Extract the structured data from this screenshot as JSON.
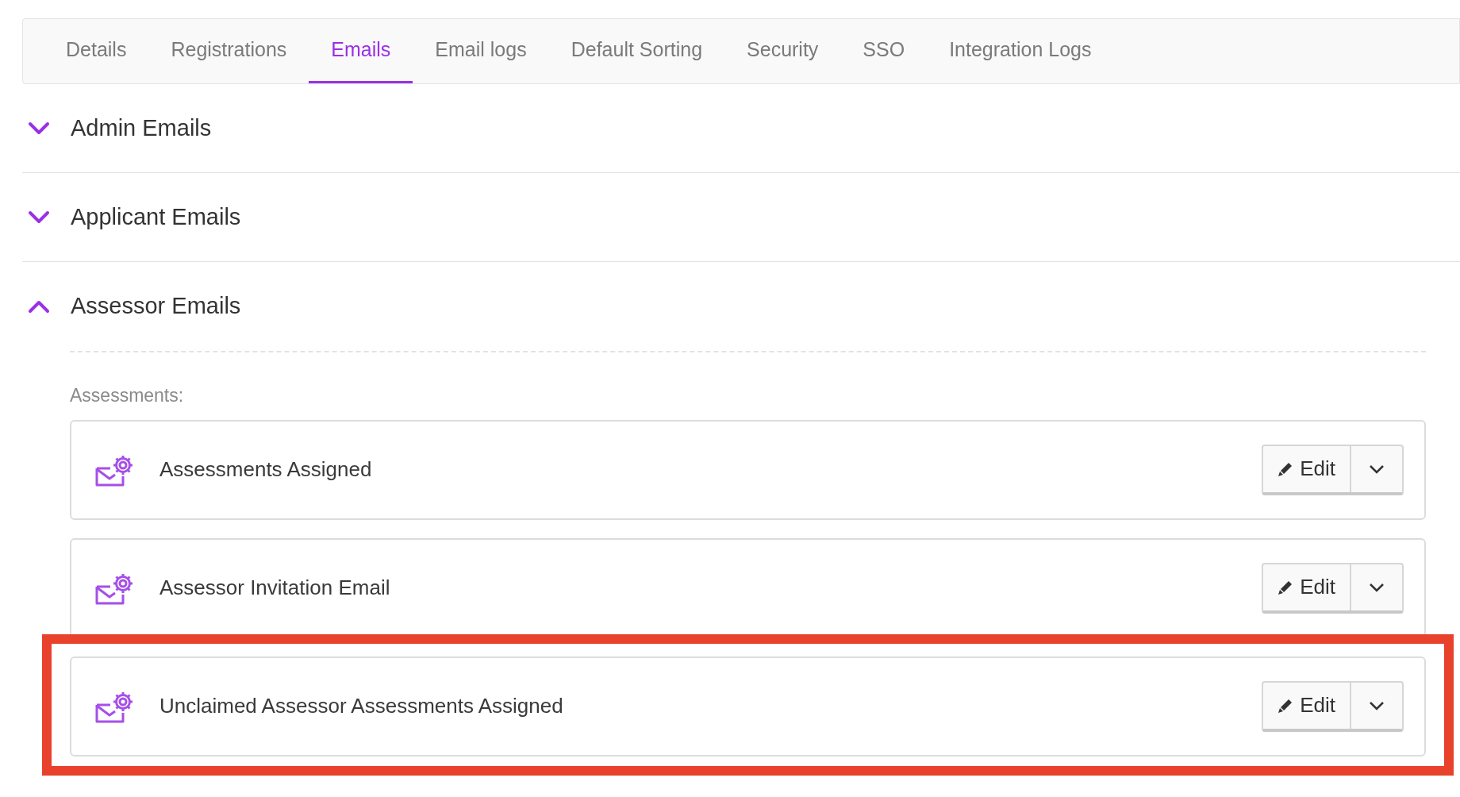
{
  "tabs": [
    {
      "label": "Details",
      "selected": false
    },
    {
      "label": "Registrations",
      "selected": false
    },
    {
      "label": "Emails",
      "selected": true
    },
    {
      "label": "Email logs",
      "selected": false
    },
    {
      "label": "Default Sorting",
      "selected": false
    },
    {
      "label": "Security",
      "selected": false
    },
    {
      "label": "SSO",
      "selected": false
    },
    {
      "label": "Integration Logs",
      "selected": false
    }
  ],
  "sections": [
    {
      "title": "Admin Emails",
      "expanded": false
    },
    {
      "title": "Applicant Emails",
      "expanded": false
    },
    {
      "title": "Assessor Emails",
      "expanded": true,
      "group_label": "Assessments:",
      "emails": [
        {
          "name": "Assessments Assigned",
          "button": "Edit",
          "highlighted": false
        },
        {
          "name": "Assessor Invitation Email",
          "button": "Edit",
          "highlighted": false
        },
        {
          "name": "Unclaimed Assessor Assessments Assigned",
          "button": "Edit",
          "highlighted": true
        }
      ]
    }
  ]
}
